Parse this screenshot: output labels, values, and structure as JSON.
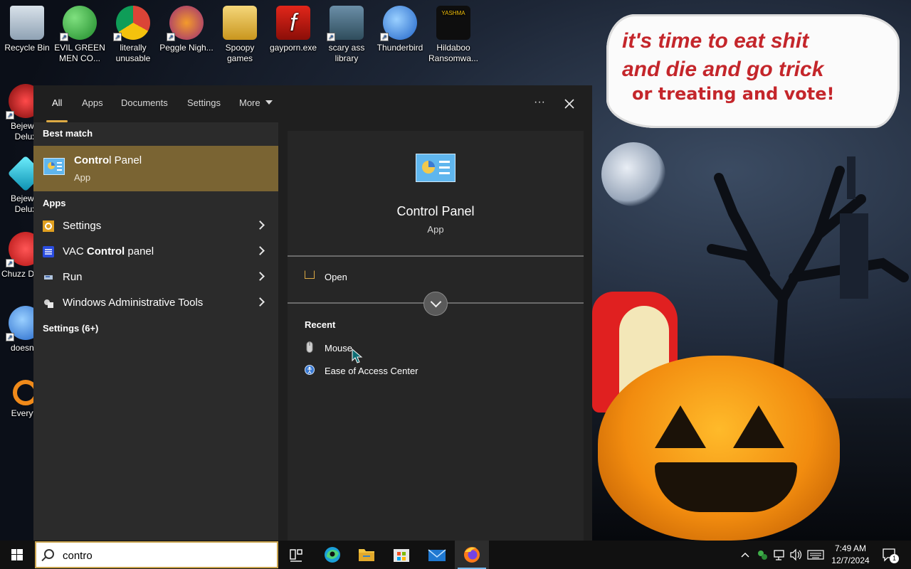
{
  "desktop": {
    "wallpaper_text_line1": "it's time to eat shit",
    "wallpaper_text_line2": "and die and go trick",
    "wallpaper_text_line3": "or treating and vote!",
    "icons": [
      {
        "label": "Recycle Bin",
        "icon": "recycle-bin-icon"
      },
      {
        "label": "EVIL GREEN MEN CO...",
        "icon": "people-icon"
      },
      {
        "label": "literally unusable",
        "icon": "chrome-icon"
      },
      {
        "label": "Peggle Nigh...",
        "icon": "peggle-icon"
      },
      {
        "label": "Spoopy games",
        "icon": "folder-icon"
      },
      {
        "label": "gayporn.exe",
        "icon": "flash-icon"
      },
      {
        "label": "scary ass library",
        "icon": "library-icon"
      },
      {
        "label": "Thunderbird",
        "icon": "thunderbird-icon"
      },
      {
        "label": "Hildaboo Ransomwa...",
        "icon": "shield-icon"
      },
      {
        "label": "Bejewel Delux",
        "icon": "bejeweled-2-icon"
      },
      {
        "label": "Bejewel Delux",
        "icon": "diamond-icon"
      },
      {
        "label": "Chuzz Delux",
        "icon": "chuzzle-icon"
      },
      {
        "label": "doesnt l",
        "icon": "thunderbird-icon"
      },
      {
        "label": "Everyth",
        "icon": "search-icon"
      }
    ],
    "icon_badge": "YASHMA"
  },
  "search_panel": {
    "tabs": [
      {
        "label": "All",
        "active": true
      },
      {
        "label": "Apps"
      },
      {
        "label": "Documents"
      },
      {
        "label": "Settings"
      },
      {
        "label": "More"
      }
    ],
    "more_options_label": "···",
    "best_match_heading": "Best match",
    "best_match": {
      "name_bold": "Contro",
      "name_rest": "l Panel",
      "type": "App",
      "icon": "control-panel-icon"
    },
    "apps_heading": "Apps",
    "apps": [
      {
        "label_pre": "Settings",
        "label_bold": "",
        "label_post": "",
        "icon": "settings-icon"
      },
      {
        "label_pre": "VAC ",
        "label_bold": "Control",
        "label_post": " panel",
        "icon": "vac-icon"
      },
      {
        "label_pre": "Run",
        "label_bold": "",
        "label_post": "",
        "icon": "run-icon"
      },
      {
        "label_pre": "Windows Administrative Tools",
        "label_bold": "",
        "label_post": "",
        "icon": "admin-tools-icon"
      }
    ],
    "settings_heading": "Settings (6+)",
    "preview": {
      "name": "Control Panel",
      "type": "App",
      "open_label": "Open",
      "recent_heading": "Recent",
      "recent": [
        {
          "label": "Mouse",
          "icon": "mouse-icon"
        },
        {
          "label": "Ease of Access Center",
          "icon": "ease-of-access-icon"
        }
      ]
    }
  },
  "taskbar": {
    "search_value": "contro",
    "apps": [
      "task-view-icon",
      "edge-icon",
      "file-explorer-icon",
      "store-icon",
      "mail-icon",
      "firefox-icon"
    ],
    "clock_time": "7:49 AM",
    "clock_date": "12/7/2024",
    "notification_count": "1"
  },
  "colors": {
    "accent": "#ddaa44",
    "best_match_bg": "#7a6433",
    "panel_bg": "#2b2b2b",
    "preview_bg": "#262626"
  }
}
